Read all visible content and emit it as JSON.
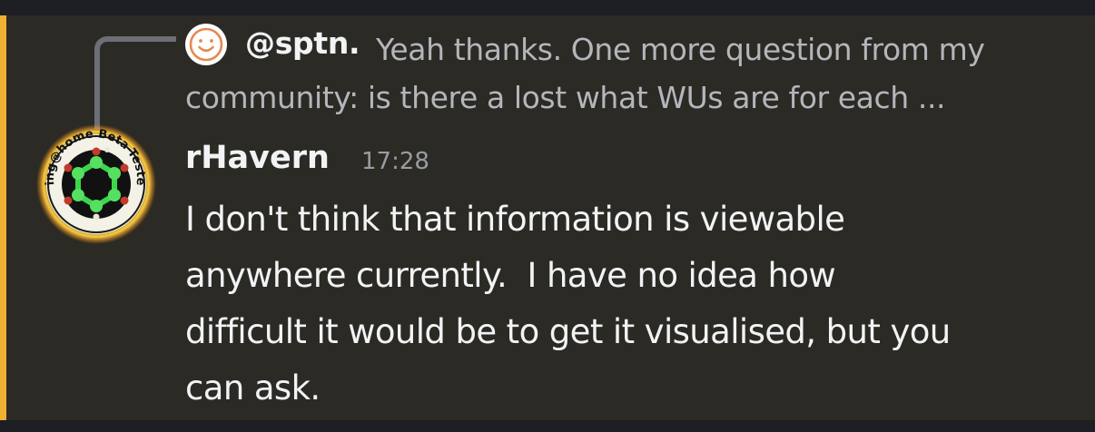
{
  "reply": {
    "author": "@sptn.",
    "text": "Yeah thanks. One more question from my community: is there a lost what WUs are for each ...",
    "avatar_icon": "smiley-face-icon"
  },
  "message": {
    "author": "rHavern",
    "timestamp": "17:28",
    "avatar_badge_text": "ing@home Beta-Tester",
    "avatar_icon": "molecule-badge-icon",
    "body": "I don't think that information is viewable\nanywhere currently.  I have no idea how\ndifficult it would be to get it visualised, but you\ncan ask."
  },
  "colors": {
    "mention_bar": "#f0b132",
    "message_bg": "#2c2a24",
    "page_bg": "#1e1f24"
  }
}
